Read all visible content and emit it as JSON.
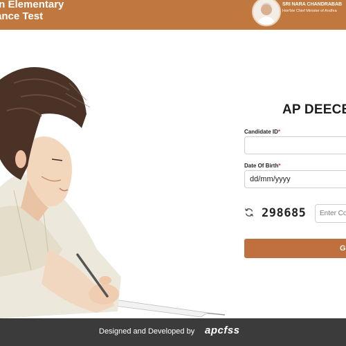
{
  "header": {
    "title_line1": "in Elementary",
    "title_line2": "ance Test",
    "cm_name": "SRI NARA CHANDRABAB",
    "cm_role": "Hon'ble Chief Minister of Andhra"
  },
  "form": {
    "title": "AP DEECET",
    "candidate_id_label": "Candidate ID",
    "candidate_id_value": "",
    "dob_label": "Date Of Birth",
    "dob_value": "dd/mm/yyyy",
    "required_mark": "*",
    "captcha_code": "298685",
    "captcha_placeholder": "Enter Co",
    "submit_label": "G"
  },
  "footer": {
    "text": "Designed and Developed by",
    "logo": "apcfss"
  },
  "colors": {
    "brand": "#c0783f",
    "footer": "#3b3b3b"
  }
}
